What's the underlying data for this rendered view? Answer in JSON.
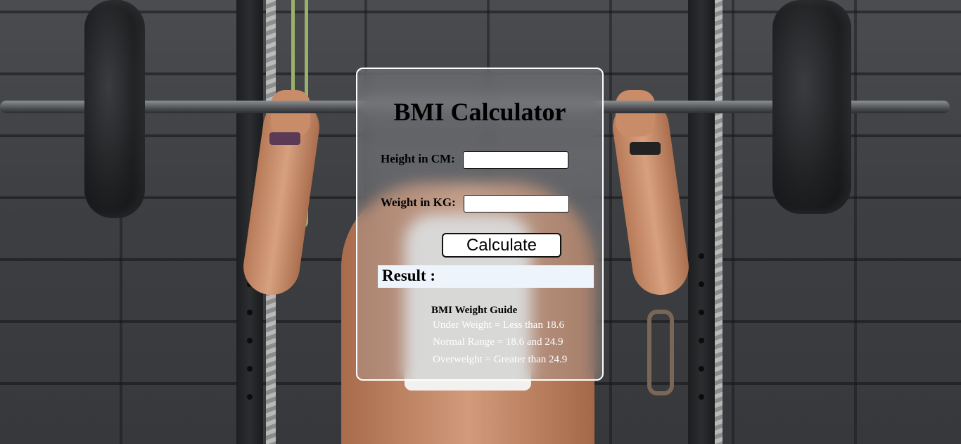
{
  "calculator": {
    "title": "BMI Calculator",
    "height_label": "Height in CM:",
    "height_value": "",
    "weight_label": "Weight in KG:",
    "weight_value": "",
    "calculate_label": "Calculate",
    "result_label": "Result :"
  },
  "guide": {
    "title": "BMI Weight Guide",
    "rows": [
      "Under Weight = Less than 18.6",
      "Normal Range = 18.6 and 24.9",
      "Overweight = Greater than 24.9"
    ]
  },
  "colors": {
    "card_border": "#ffffff",
    "result_background": "#eef4fb",
    "guide_text": "#ffffff"
  }
}
